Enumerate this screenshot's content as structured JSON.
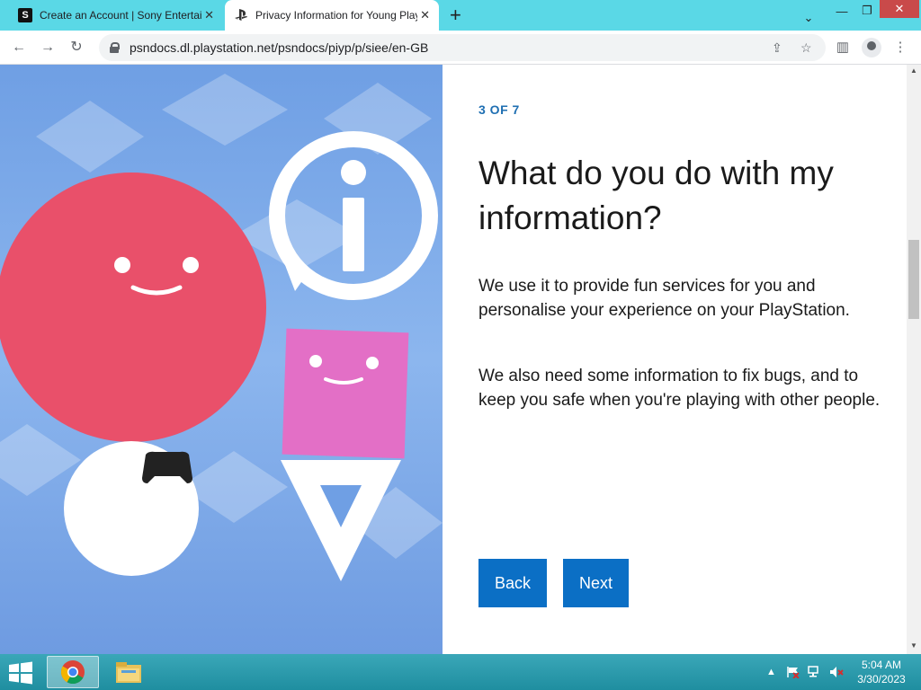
{
  "browser": {
    "tabs": [
      {
        "title": "Create an Account | Sony Entertainment Network",
        "favicon": "S",
        "active": false
      },
      {
        "title": "Privacy Information for Young Players",
        "favicon": "playstation-icon",
        "active": true
      }
    ],
    "url": "psndocs.dl.playstation.net/psndocs/piyp/p/siee/en-GB"
  },
  "page": {
    "step": "3 OF 7",
    "heading": "What do you do with my information?",
    "paragraphs": [
      "We use it to provide fun services for you and personalise your experience on your PlayStation.",
      "We also need some information to fix bugs, and to keep you safe when you're playing with other people."
    ],
    "buttons": {
      "back": "Back",
      "next": "Next"
    },
    "colors": {
      "accent": "#0b6fc5",
      "step": "#1f6fb2",
      "illustration_bg": "#7ba8e8",
      "circle": "#e9506a",
      "square": "#e36fc6"
    }
  },
  "taskbar": {
    "time": "5:04 AM",
    "date": "3/30/2023"
  }
}
